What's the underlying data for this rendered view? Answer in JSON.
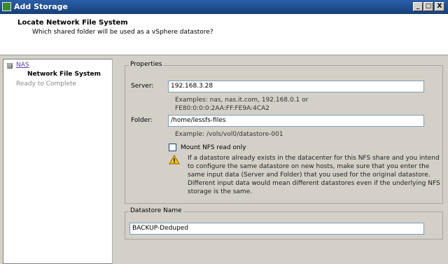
{
  "window": {
    "title": "Add Storage",
    "min_label": "_",
    "max_label": "□",
    "close_label": "X"
  },
  "header": {
    "title": "Locate Network File System",
    "subtitle": "Which shared folder will be used as a vSphere datastore?"
  },
  "nav": {
    "toggle": "⊟",
    "items": [
      "NAS",
      "Network File System",
      "Ready to Complete"
    ]
  },
  "properties": {
    "legend": "Properties",
    "server_label": "Server:",
    "server_value": "192.168.3.28",
    "server_examples_1": "Examples: nas, nas.it.com, 192.168.0.1 or",
    "server_examples_2": "FE80:0:0:0:2AA:FF:FE9A:4CA2",
    "folder_label": "Folder:",
    "folder_value": "/home/lessfs-files",
    "folder_example": "Example: /vols/vol0/datastore-001",
    "mount_readonly_label": "Mount NFS read only",
    "mount_readonly_checked": false,
    "warning_lines": [
      "If a datastore already exists in the datacenter for this NFS share and you intend",
      "to configure the same datastore on new hosts, make sure that you enter the",
      "same input data (Server and Folder) that you used for the original datastore.",
      "Different input data would mean different datastores even if the underlying NFS",
      "storage is the same."
    ]
  },
  "datastore": {
    "legend": "Datastore Name",
    "name_value": "BACKUP-Deduped"
  }
}
